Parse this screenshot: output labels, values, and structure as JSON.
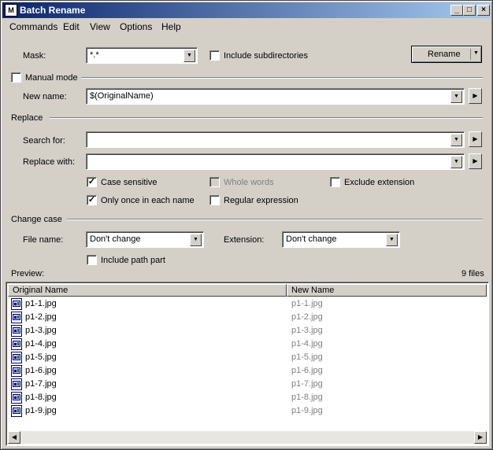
{
  "window": {
    "title": "Batch Rename",
    "app_icon_text": "M"
  },
  "titlebar": {
    "minimize": "_",
    "maximize": "□",
    "close": "×"
  },
  "menu": [
    "Commands",
    "Edit",
    "View",
    "Options",
    "Help"
  ],
  "mask": {
    "label": "Mask:",
    "value": "*.*"
  },
  "include_subdirectories": {
    "label": "Include subdirectories",
    "checked": false
  },
  "rename_button": {
    "label": "Rename"
  },
  "manual_mode": {
    "label": "Manual mode",
    "checked": false
  },
  "new_name": {
    "label": "New name:",
    "value": "$(OriginalName)"
  },
  "replace": {
    "group_label": "Replace",
    "search_label": "Search for:",
    "search_value": "",
    "replace_label": "Replace with:",
    "replace_value": "",
    "case_sensitive": {
      "label": "Case sensitive",
      "checked": true
    },
    "whole_words": {
      "label": "Whole words",
      "checked": false,
      "disabled": true
    },
    "exclude_extension": {
      "label": "Exclude extension",
      "checked": false
    },
    "only_once": {
      "label": "Only once in each name",
      "checked": true
    },
    "regular_expression": {
      "label": "Regular expression",
      "checked": false
    }
  },
  "change_case": {
    "group_label": "Change case",
    "file_name_label": "File name:",
    "file_name_value": "Don't change",
    "extension_label": "Extension:",
    "extension_value": "Don't change",
    "include_path_part": {
      "label": "Include path part",
      "checked": false
    }
  },
  "preview": {
    "label": "Preview:",
    "count": "9 files",
    "columns": [
      "Original Name",
      "New Name"
    ],
    "rows": [
      {
        "original": "p1-1.jpg",
        "new": "p1-1.jpg"
      },
      {
        "original": "p1-2.jpg",
        "new": "p1-2.jpg"
      },
      {
        "original": "p1-3.jpg",
        "new": "p1-3.jpg"
      },
      {
        "original": "p1-4.jpg",
        "new": "p1-4.jpg"
      },
      {
        "original": "p1-5.jpg",
        "new": "p1-5.jpg"
      },
      {
        "original": "p1-6.jpg",
        "new": "p1-6.jpg"
      },
      {
        "original": "p1-7.jpg",
        "new": "p1-7.jpg"
      },
      {
        "original": "p1-8.jpg",
        "new": "p1-8.jpg"
      },
      {
        "original": "p1-9.jpg",
        "new": "p1-9.jpg"
      }
    ]
  },
  "icons": {
    "dropdown": "▼",
    "side_arrow": "▶",
    "scroll_left": "◀",
    "scroll_right": "▶",
    "check_mark": "✓"
  }
}
